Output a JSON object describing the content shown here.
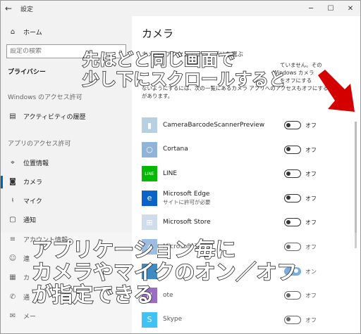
{
  "window": {
    "title": "設定",
    "back_glyph": "←",
    "min_glyph": "─",
    "max_glyph": "☐",
    "close_glyph": "✕"
  },
  "sidebar": {
    "home_label": "ホーム",
    "search_placeholder": "設定の検索",
    "privacy_title": "プライバシー",
    "windows_section": "Windows のアクセス許可",
    "activity_label": "アクティビティの履歴",
    "app_section": "アプリのアクセス許可",
    "items": [
      {
        "label": "位置情報",
        "icon": "location-icon",
        "glyph": "⌖"
      },
      {
        "label": "カメラ",
        "icon": "camera-icon",
        "glyph": "◙"
      },
      {
        "label": "マイク",
        "icon": "microphone-icon",
        "glyph": "♮"
      },
      {
        "label": "通知",
        "icon": "notification-icon",
        "glyph": "▢"
      },
      {
        "label": "アカウント情報",
        "icon": "account-icon",
        "glyph": "≡"
      },
      {
        "label": "連",
        "icon": "contacts-icon",
        "glyph": "☺"
      },
      {
        "label": "カ",
        "icon": "calendar-icon",
        "glyph": "▦"
      },
      {
        "label": "通",
        "icon": "call-icon",
        "glyph": "✆"
      },
      {
        "label": "メー",
        "icon": "mail-icon",
        "glyph": "✉"
      }
    ]
  },
  "main": {
    "title": "カメラ",
    "section_heading": "カメラにアクセスできるアプリを選ぶ",
    "desc_lines": [
      "にアクセスできません。このデバイスでカメラへのアクセスが",
      "ますが、次の一覧にあるカメラ アプリへの",
      "のカメラ アプリへのアクセスをオフにすると、",
      "ないようにするには、次の一覧にあるカメラ アプリへのアクセスもオフにする必要",
      "があります。"
    ],
    "desc_partial_a": "ていません。その",
    "desc_partial_b": "Windows カメラ",
    "desc_partial_c": "をオフにする",
    "apps": [
      {
        "name": "CameraBarcodeScannerPreview",
        "sub": "",
        "state": "オフ",
        "on": false,
        "color": "#b7cfe2",
        "icon": "barcode-scanner-icon",
        "glyph": "▮"
      },
      {
        "name": "Cortana",
        "sub": "",
        "state": "オフ",
        "on": false,
        "color": "#8fb3d9",
        "icon": "cortana-icon",
        "glyph": "○"
      },
      {
        "name": "LINE",
        "sub": "",
        "state": "オフ",
        "on": false,
        "color": "#00b900",
        "icon": "line-icon",
        "glyph": "LINE"
      },
      {
        "name": "Microsoft Edge",
        "sub": "サイトに許可が必要",
        "state": "オフ",
        "on": false,
        "color": "#0a63c9",
        "icon": "edge-icon",
        "glyph": "e"
      },
      {
        "name": "Microsoft Store",
        "sub": "",
        "state": "オフ",
        "on": false,
        "color": "#cfdcea",
        "icon": "store-icon",
        "glyph": "⊞"
      },
      {
        "name": "Microsoft フォト",
        "sub": "",
        "state": "オフ",
        "on": false,
        "color": "#7aa7d8",
        "icon": "photos-icon",
        "glyph": "▲"
      },
      {
        "name": "",
        "sub": "",
        "state": "オン",
        "on": true,
        "color": "#0063b1",
        "icon": "app-icon",
        "glyph": ""
      },
      {
        "name": "ote",
        "sub": "",
        "state": "オフ",
        "on": false,
        "color": "#7a3bb0",
        "icon": "onenote-icon",
        "glyph": "N"
      },
      {
        "name": "Skype",
        "sub": "",
        "state": "オフ",
        "on": false,
        "color": "#00aff0",
        "icon": "skype-icon",
        "glyph": "S"
      }
    ]
  },
  "annotations": {
    "top_line1": "先ほどと同じ画面で",
    "top_line2": "少し下にスクロールすると",
    "bottom_line1": "アプリケーション毎に",
    "bottom_line2": "カメラやマイクのオン／オフ",
    "bottom_line3": "が指定できる",
    "arrow_color": "#d40000"
  }
}
